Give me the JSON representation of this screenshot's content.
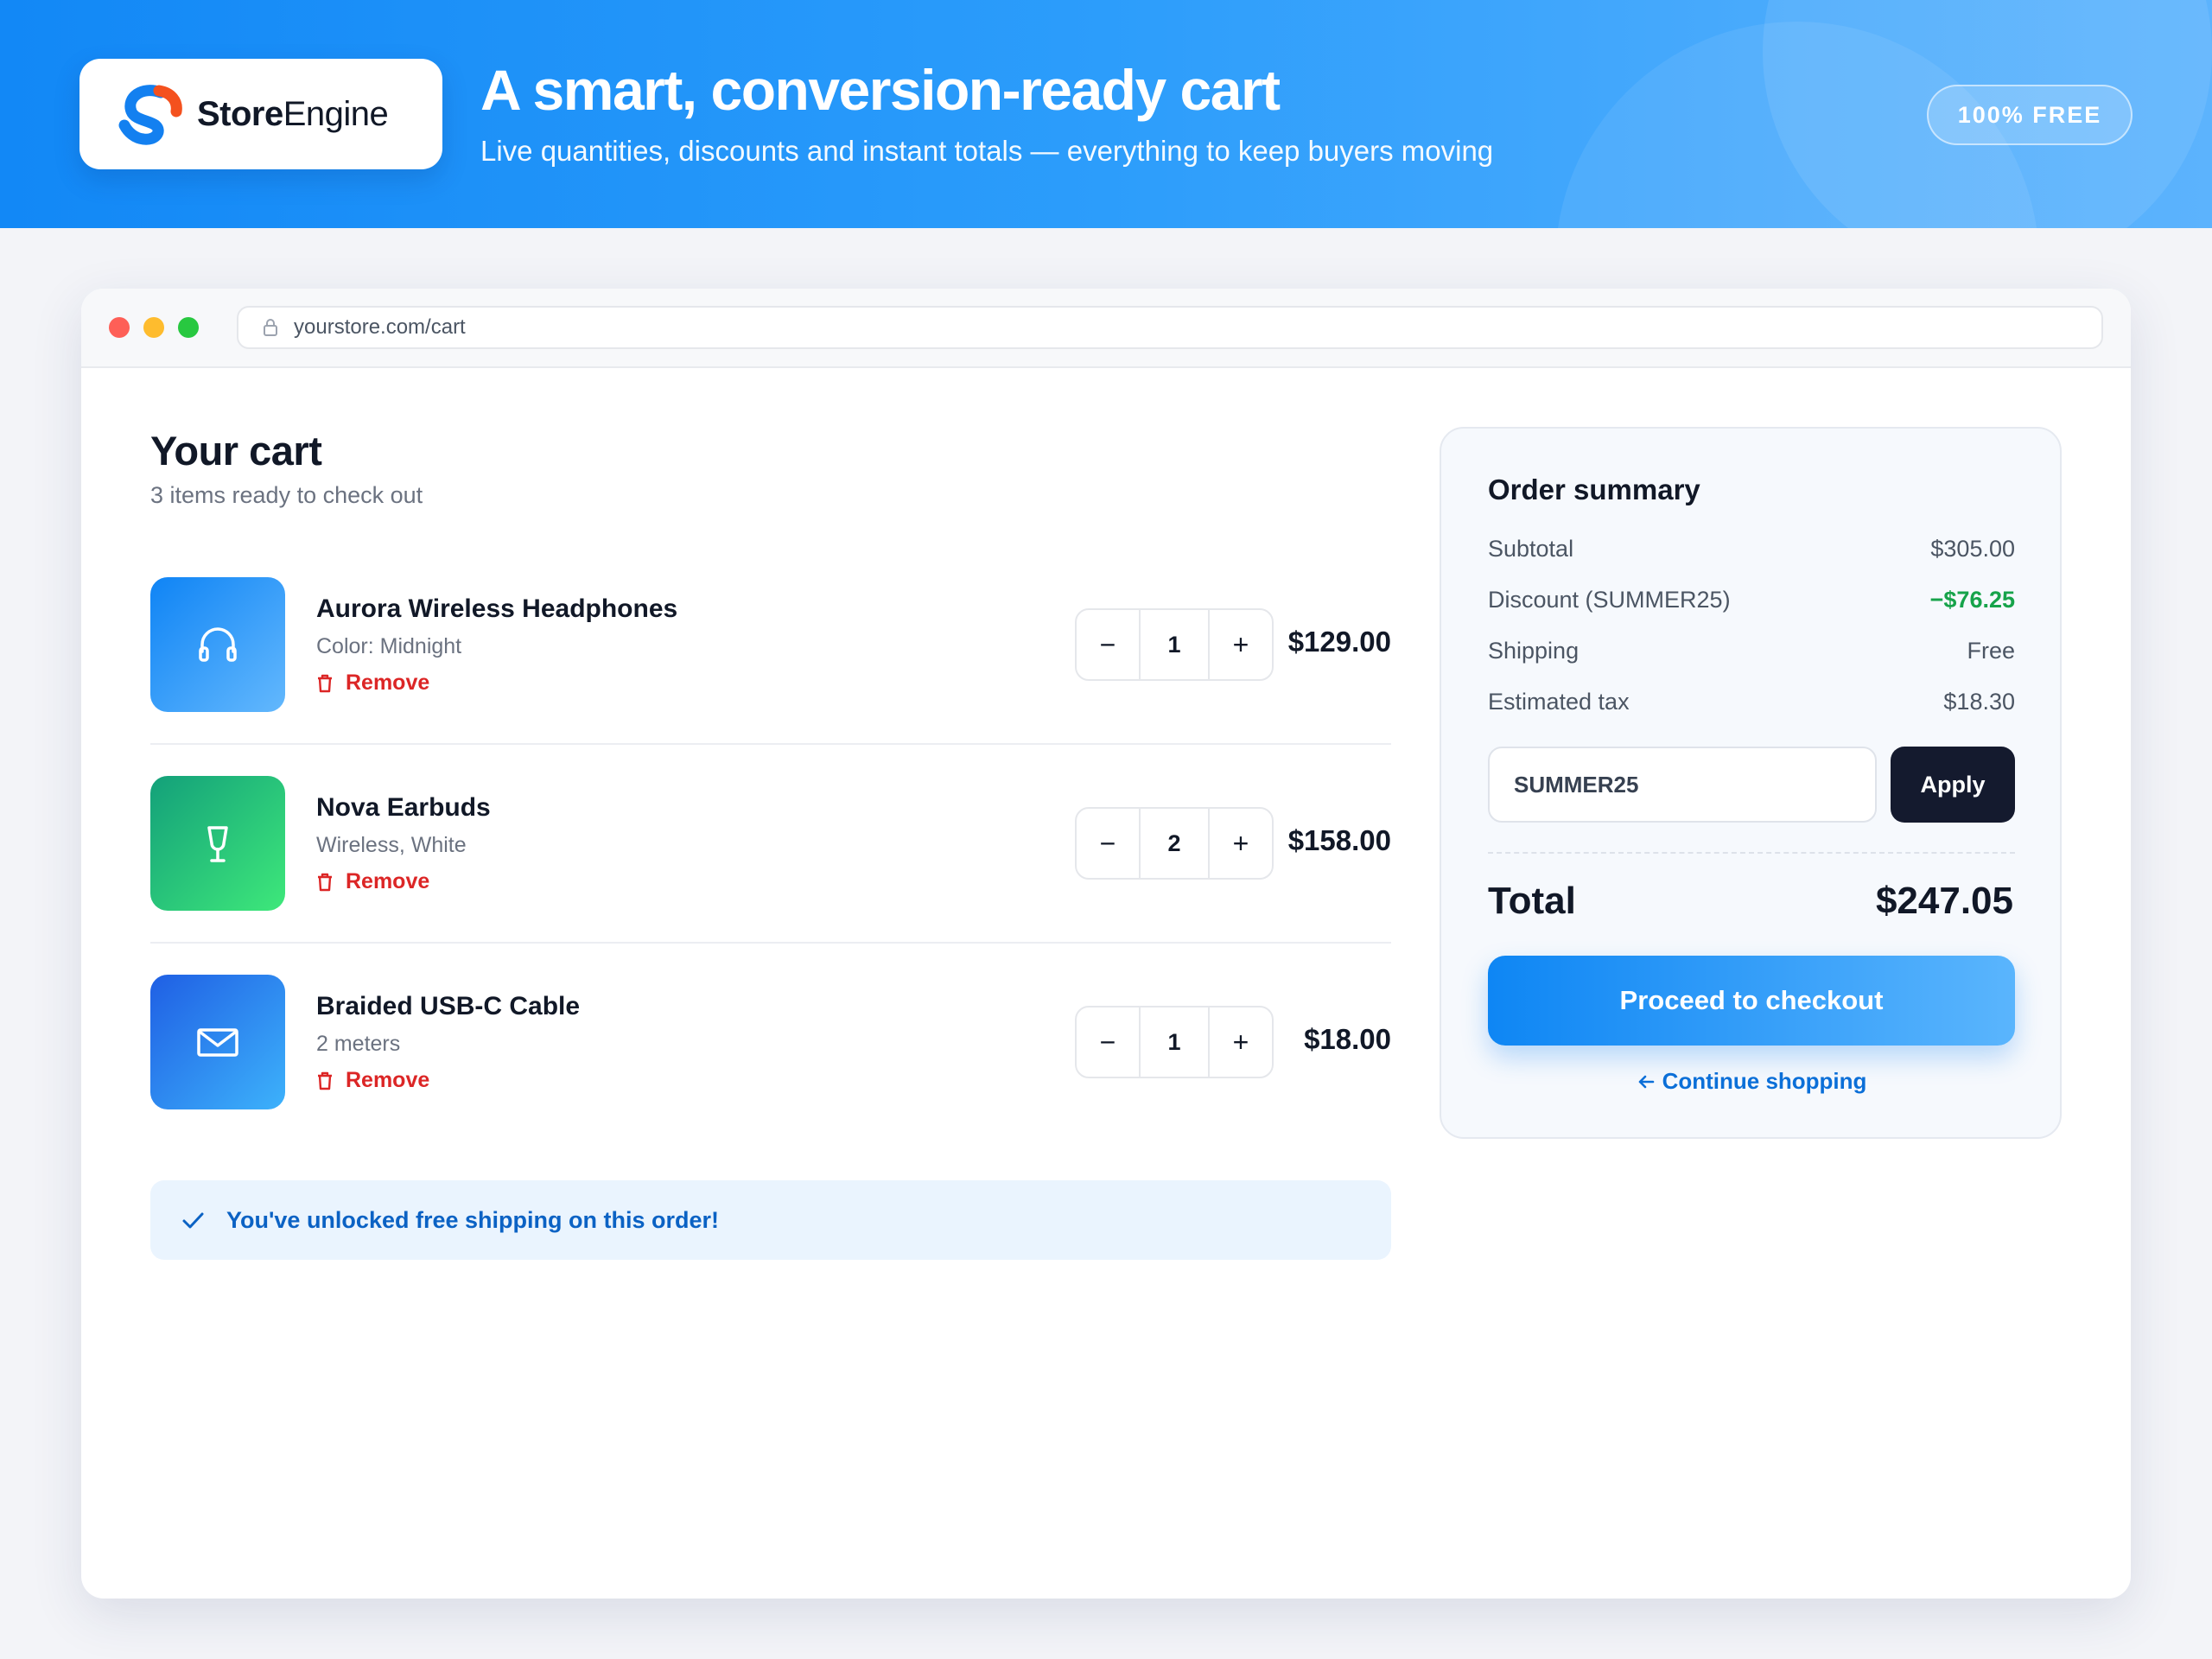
{
  "banner": {
    "brand_bold": "Store",
    "brand_light": "Engine",
    "title": "A smart, conversion-ready cart",
    "subtitle": "Live quantities, discounts and instant totals — everything to keep buyers moving",
    "badge": "100% FREE"
  },
  "browser": {
    "url": "yourstore.com/cart"
  },
  "cart": {
    "title": "Your cart",
    "subtitle": "3 items ready to check out",
    "items": [
      {
        "name": "Aurora Wireless Headphones",
        "variant": "Color: Midnight",
        "remove_label": "Remove",
        "quantity": "1",
        "price": "$129.00",
        "icon": "headphones-icon",
        "color": "#1a8cf7"
      },
      {
        "name": "Nova Earbuds",
        "variant": "Wireless, White",
        "remove_label": "Remove",
        "quantity": "2",
        "price": "$158.00",
        "icon": "earbud-icon",
        "color": "#1fb17a"
      },
      {
        "name": "Braided USB-C Cable",
        "variant": "2 meters",
        "remove_label": "Remove",
        "quantity": "1",
        "price": "$18.00",
        "icon": "mail-icon",
        "color": "#2469e6"
      }
    ],
    "stepper": {
      "minus": "−",
      "plus": "+"
    },
    "shipping_notice": "You've unlocked free shipping on this order!"
  },
  "summary": {
    "title": "Order summary",
    "rows": [
      {
        "label": "Subtotal",
        "value": "$305.00"
      },
      {
        "label": "Discount (SUMMER25)",
        "value": "−$76.25"
      },
      {
        "label": "Shipping",
        "value": "Free"
      },
      {
        "label": "Estimated tax",
        "value": "$18.30"
      }
    ],
    "promo_value": "SUMMER25",
    "apply_label": "Apply",
    "total_label": "Total",
    "total_value": "$247.05",
    "checkout_label": "Proceed to checkout",
    "continue_label": "Continue shopping"
  },
  "colors": {
    "accent": "#1288f6",
    "discount": "#16a34a",
    "remove": "#dc2626",
    "dark_button": "#141a2e"
  }
}
